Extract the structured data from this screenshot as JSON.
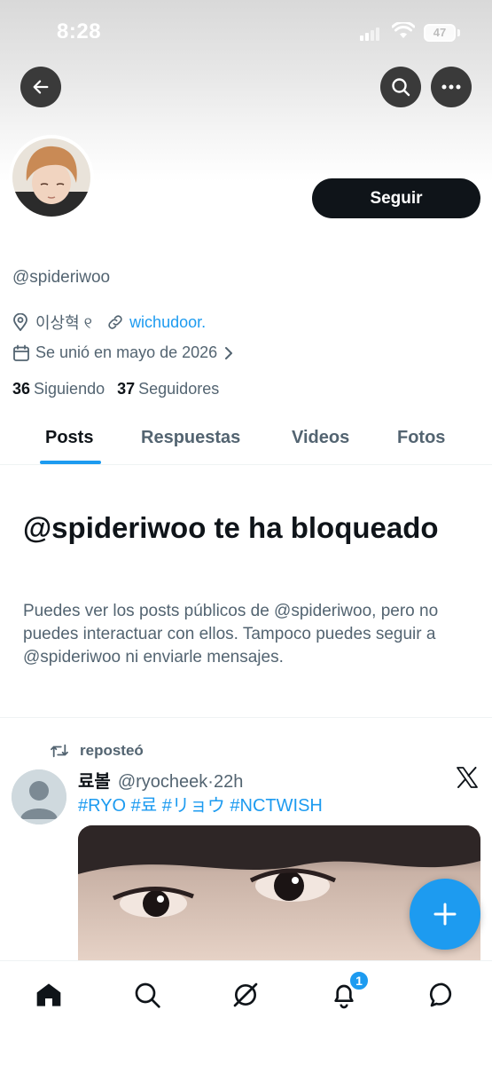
{
  "status_bar": {
    "time": "8:28",
    "battery": "47"
  },
  "profile": {
    "follow_label": "Seguir",
    "handle": "@spideriwoo",
    "location": "이상혁 ୧",
    "website": "wichudoor.",
    "joined": "Se unió en mayo de 2026",
    "following_count": "36",
    "following_label": "Siguiendo",
    "followers_count": "37",
    "followers_label": "Seguidores"
  },
  "tabs": [
    {
      "label": "Posts",
      "active": true
    },
    {
      "label": "Respuestas",
      "active": false
    },
    {
      "label": "Videos",
      "active": false
    },
    {
      "label": "Fotos",
      "active": false
    }
  ],
  "blocked": {
    "title": "@spideriwoo te ha bloqueado",
    "description": "Puedes ver los posts públicos de @spideriwoo, pero no puedes interactuar con ellos. Tampoco puedes seguir a @spideriwoo ni enviarle mensajes."
  },
  "post": {
    "repost_text": "reposteó",
    "author_name": "료볼",
    "author_handle": "@ryocheek",
    "separator": "·",
    "time": "22h",
    "tags": "#RYO #료 #リョウ #NCTWISH"
  },
  "nav": {
    "notification_badge": "1",
    "icons": [
      "home-icon",
      "search-icon",
      "grok-icon",
      "bell-icon",
      "messages-icon"
    ]
  },
  "colors": {
    "accent": "#1d9bf0",
    "text": "#0f1419",
    "muted": "#536471"
  }
}
